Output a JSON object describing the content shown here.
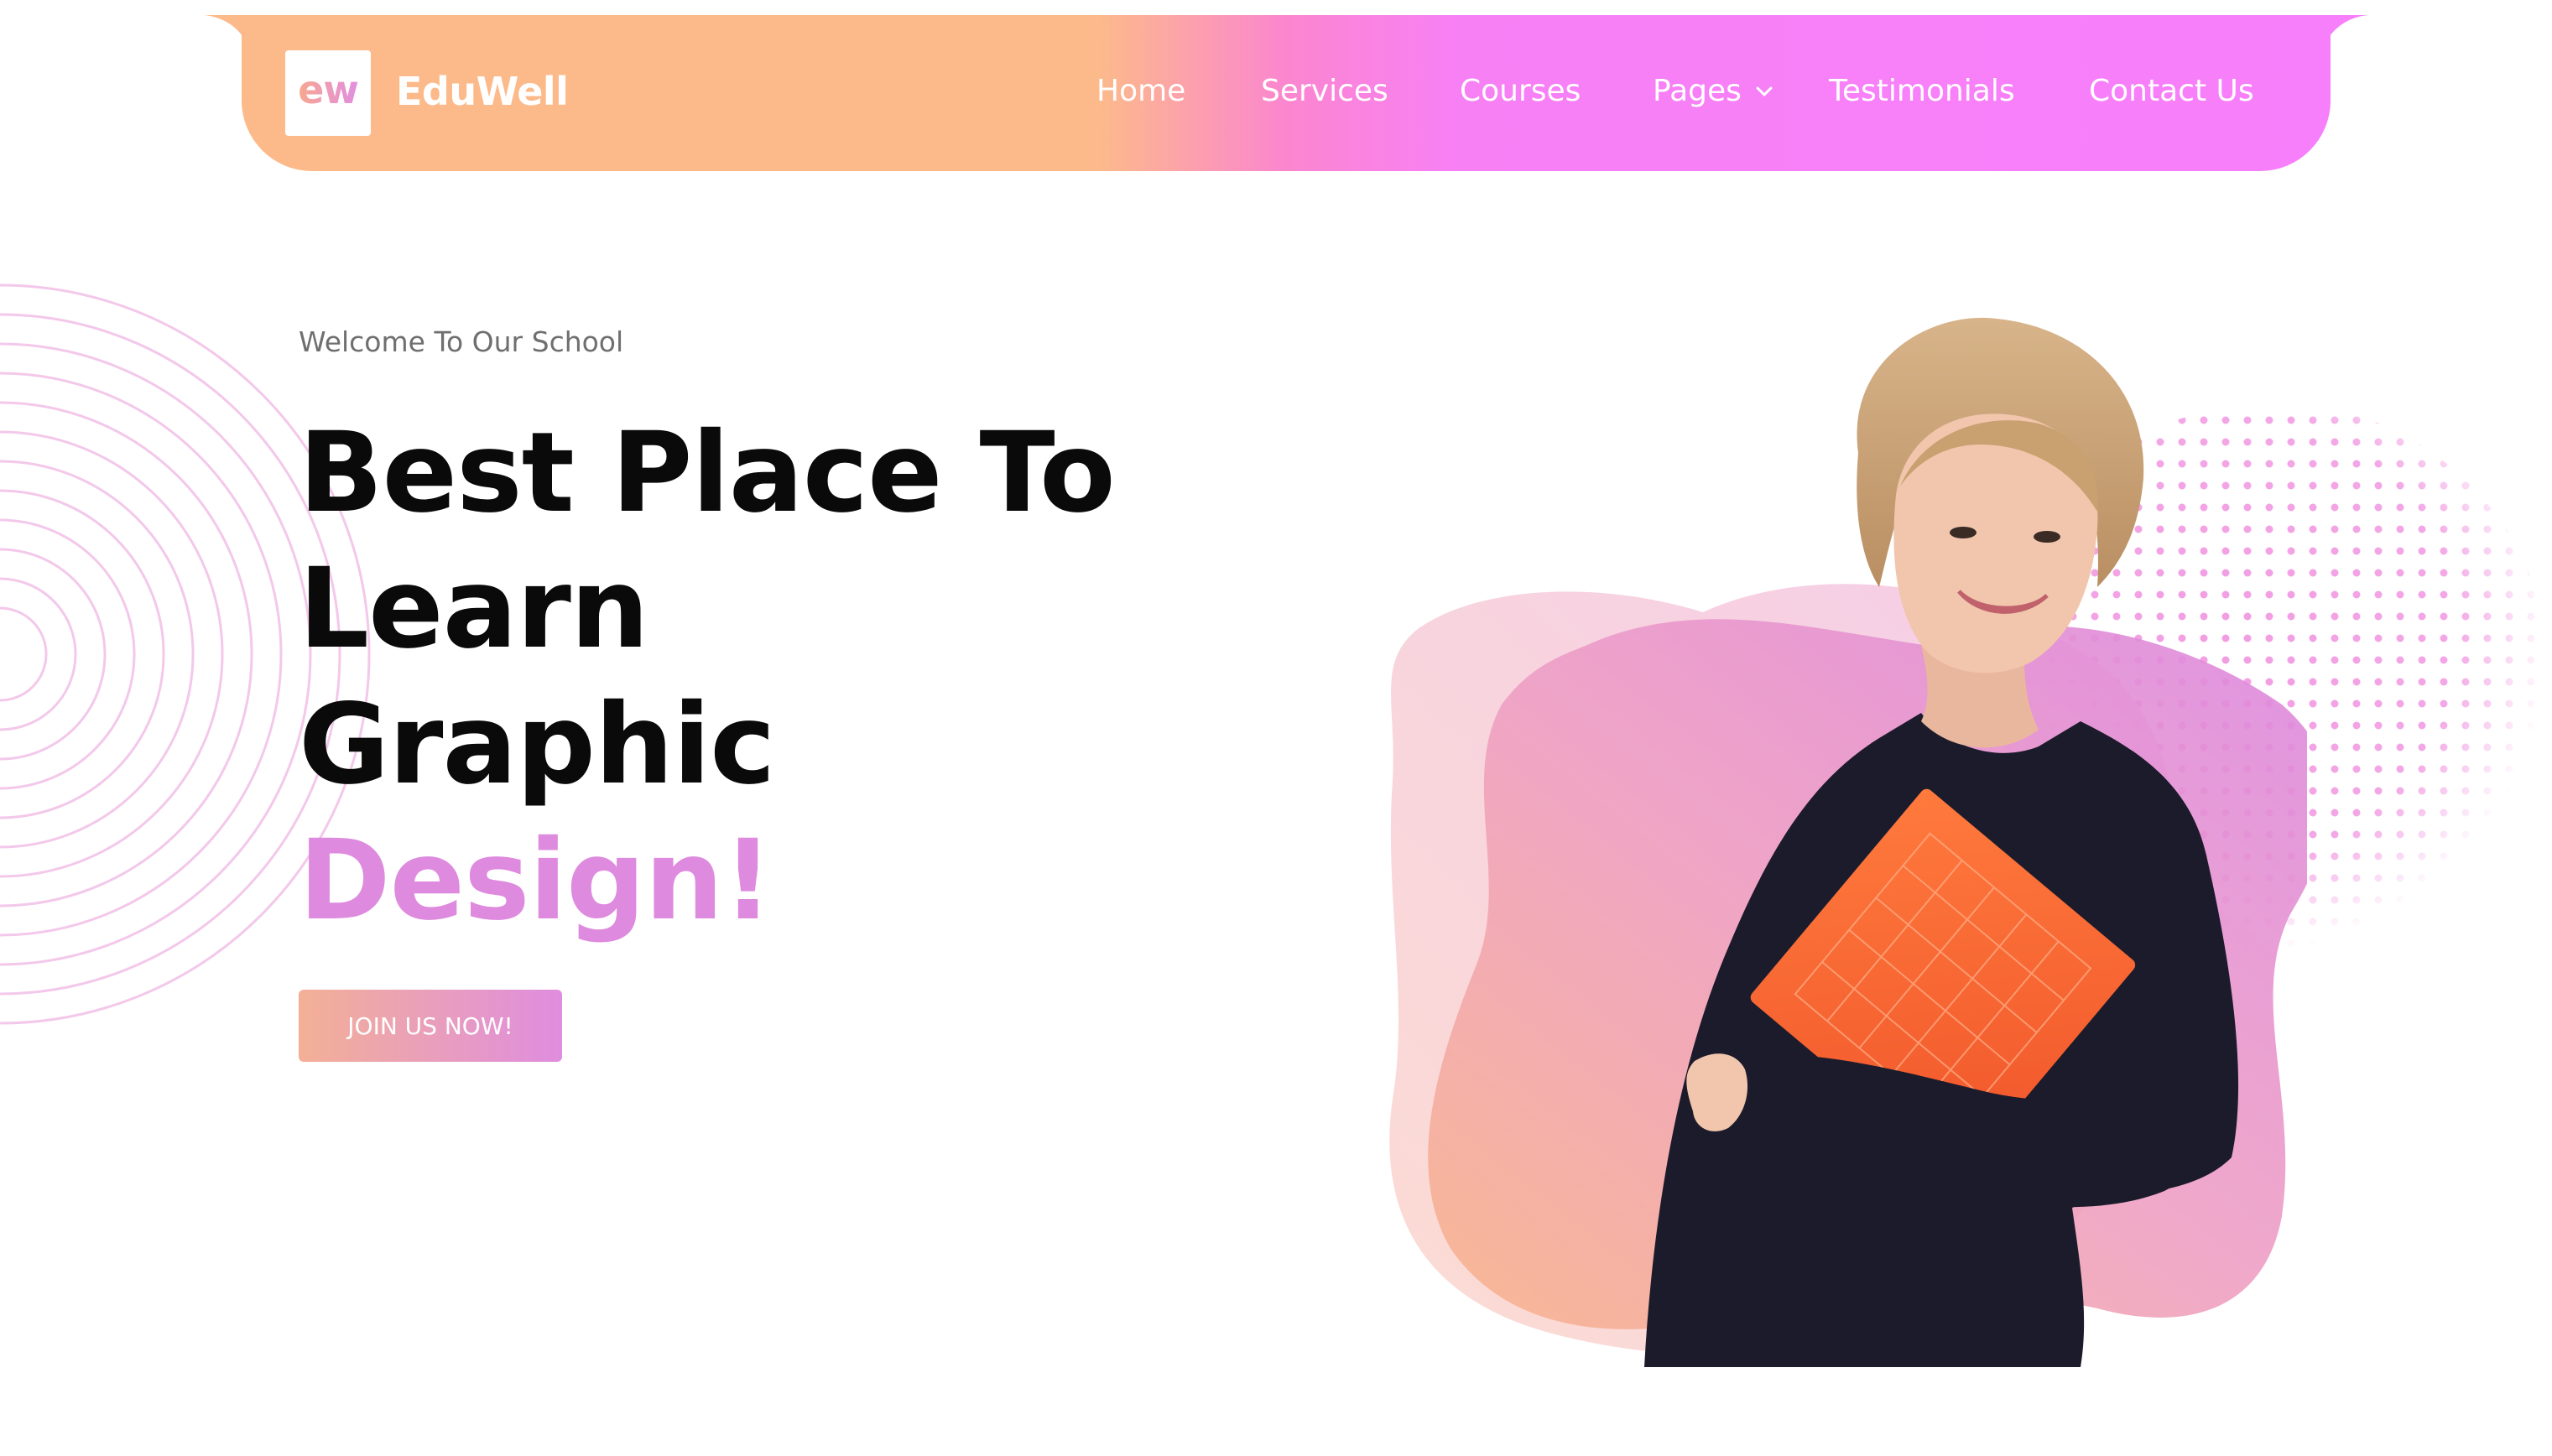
{
  "header": {
    "logo_text": "ew",
    "brand": "EduWell",
    "nav": [
      {
        "label": "Home"
      },
      {
        "label": "Services"
      },
      {
        "label": "Courses"
      },
      {
        "label": "Pages"
      },
      {
        "label": "Testimonials"
      },
      {
        "label": "Contact Us"
      }
    ]
  },
  "hero": {
    "eyebrow": "Welcome To Our School",
    "headline_lines": [
      "Best Place To",
      "Learn",
      "Graphic"
    ],
    "headline_accent": "Design!",
    "cta_label": "JOIN US NOW!"
  },
  "colors": {
    "header_start": "#fcba8a",
    "header_end": "#f77ffb",
    "accent": "#de8ade",
    "cta_start": "#f3b096",
    "cta_end": "#df8ddf",
    "headline": "#0a0a0a"
  },
  "icons": {
    "pages_dropdown": "chevron-down-icon"
  }
}
